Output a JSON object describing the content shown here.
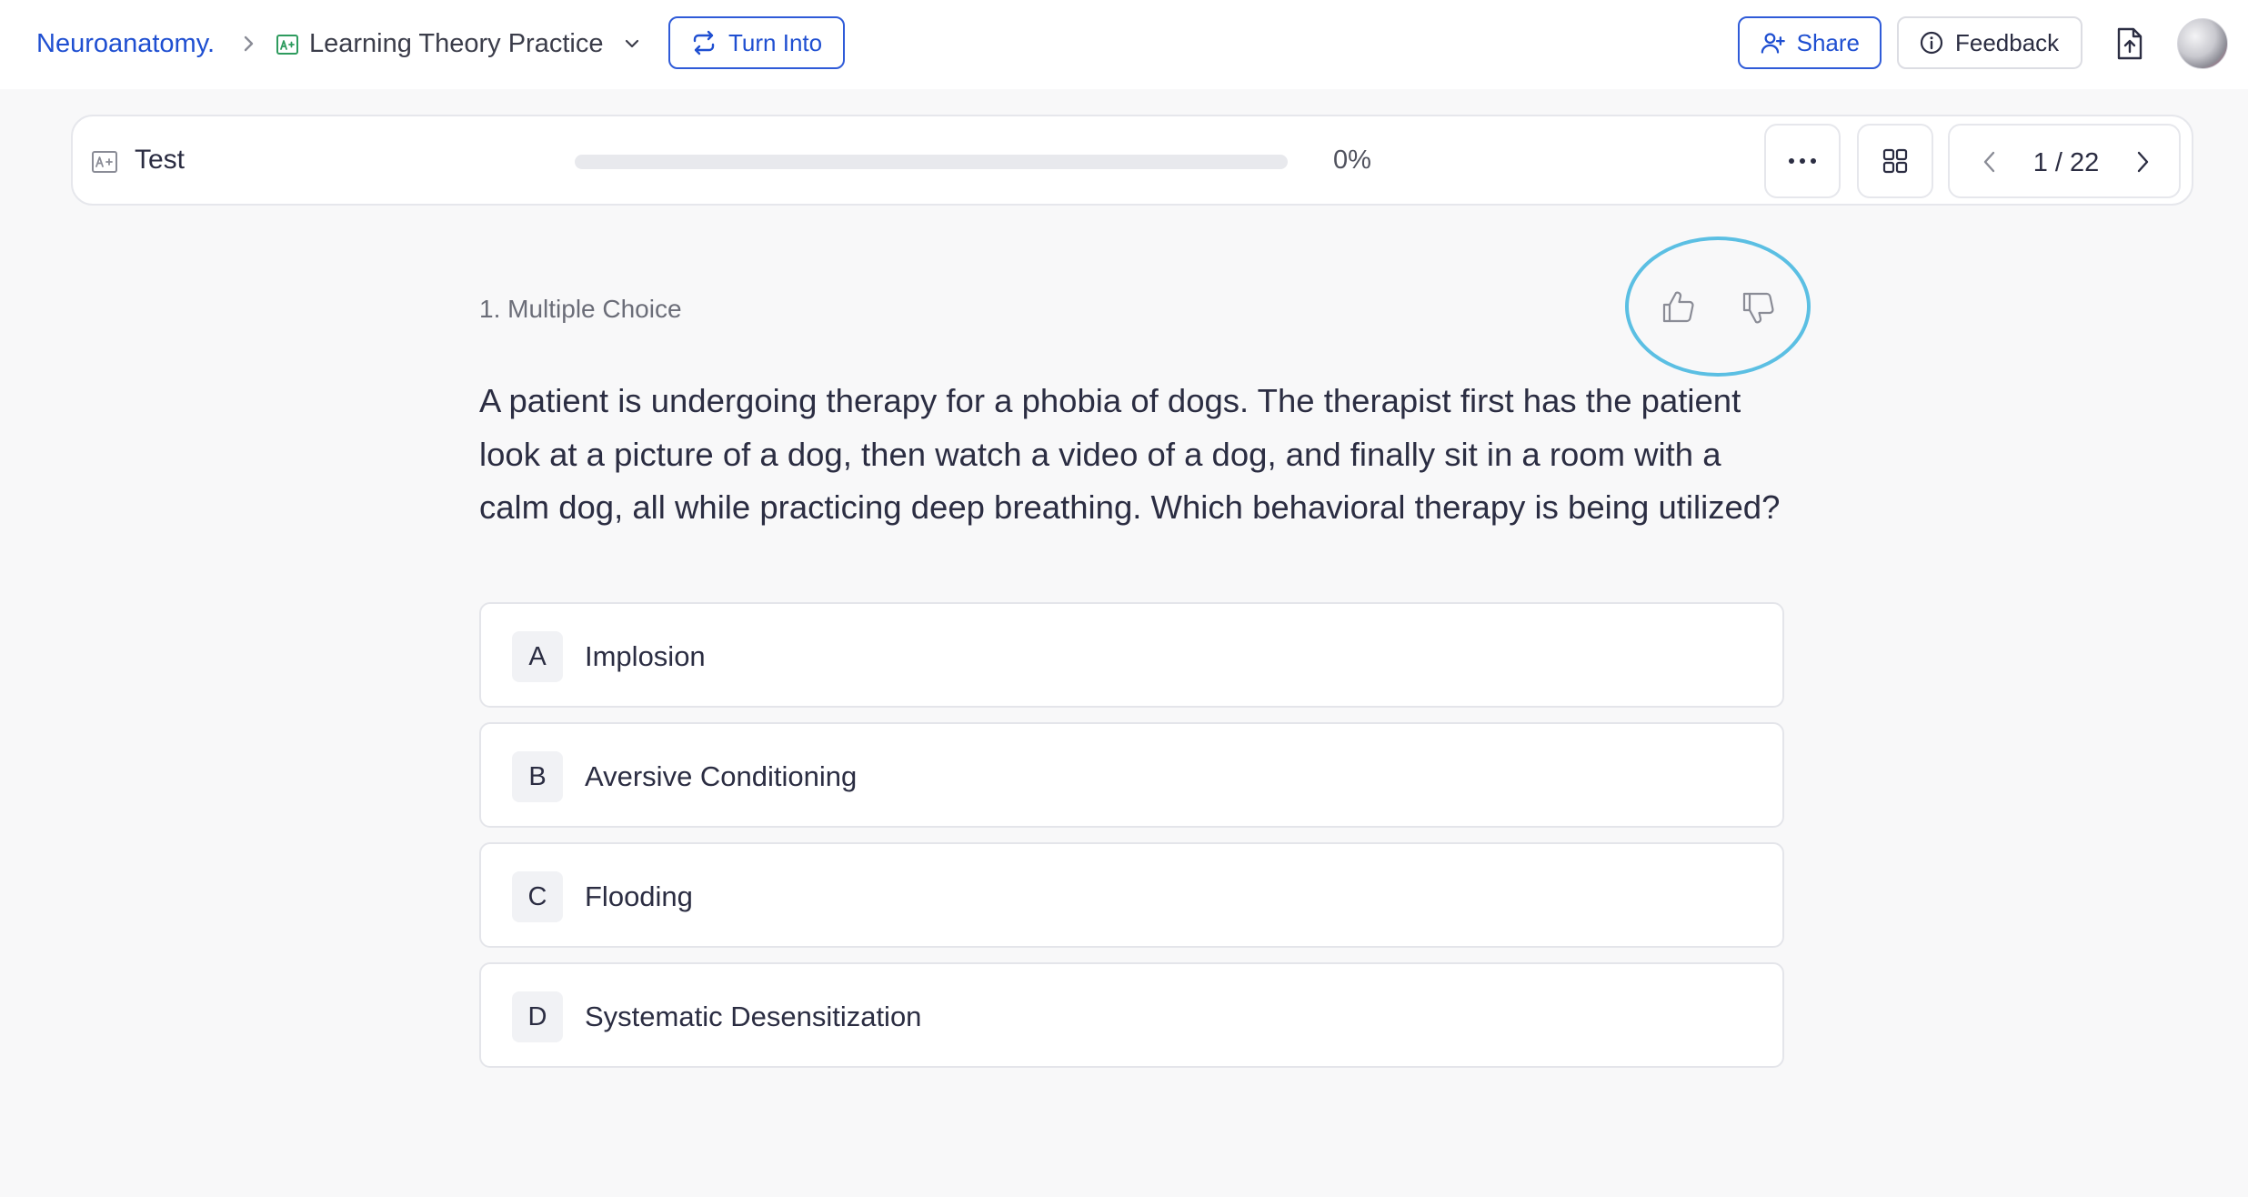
{
  "header": {
    "workspace": "Neuroanatomy.",
    "page_title": "Learning Theory Practice",
    "turn_into_label": "Turn Into",
    "share_label": "Share",
    "feedback_label": "Feedback"
  },
  "testbar": {
    "label": "Test",
    "progress_value": 0,
    "progress_text": "0%",
    "pager_text": "1 / 22"
  },
  "question": {
    "type_label": "1. Multiple Choice",
    "text": "A patient is undergoing therapy for a phobia of dogs. The therapist first has the patient look at a picture of a dog, then watch a video of a dog, and finally sit in a room with a calm dog, all while practicing deep breathing. Which behavioral therapy is being utilized?",
    "options": [
      {
        "letter": "A",
        "text": "Implosion"
      },
      {
        "letter": "B",
        "text": "Aversive Conditioning"
      },
      {
        "letter": "C",
        "text": "Flooding"
      },
      {
        "letter": "D",
        "text": "Systematic Desensitization"
      }
    ]
  },
  "colors": {
    "brand": "#1f4fd1",
    "highlight_circle": "#5bbfe3",
    "crumb_icon": "#2e9b5e"
  },
  "icons": {
    "breadcrumb_sep": "chevron-right-icon",
    "page_type": "test-icon",
    "turn_into": "repeat-icon",
    "share": "add-user-icon",
    "feedback": "info-icon",
    "export": "file-upload-icon",
    "more": "more-horizontal-icon",
    "grid": "grid-icon",
    "prev": "chevron-left-icon",
    "next": "chevron-right-icon",
    "thumb_up": "thumbs-up-icon",
    "thumb_down": "thumbs-down-icon"
  }
}
